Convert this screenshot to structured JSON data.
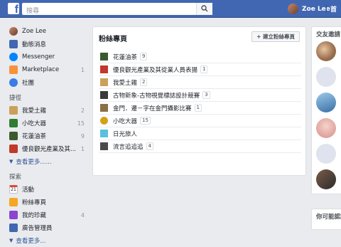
{
  "topbar": {
    "search_placeholder": "搜尋",
    "user_name": "Zoe Lee",
    "home": "首"
  },
  "sidebar": {
    "profile": "Zoe Lee",
    "items": [
      {
        "label": "動態消息",
        "count": ""
      },
      {
        "label": "Messenger",
        "count": ""
      },
      {
        "label": "Marketplace",
        "count": "1"
      },
      {
        "label": "社團",
        "count": ""
      }
    ],
    "shortcuts_title": "捷徑",
    "shortcuts": [
      {
        "label": "我愛土雞",
        "count": "2"
      },
      {
        "label": "小吃大器",
        "count": "15"
      },
      {
        "label": "花蓮油茶",
        "count": "9"
      },
      {
        "label": "優良觀光產業及其...",
        "count": "1"
      }
    ],
    "see_more_1": "查看更多......",
    "explore_title": "探索",
    "explore": [
      {
        "label": "活動",
        "count": "",
        "icon_text": "21"
      },
      {
        "label": "粉絲專頁",
        "count": ""
      },
      {
        "label": "我的珍藏",
        "count": "4"
      },
      {
        "label": "廣告管理員",
        "count": ""
      }
    ],
    "see_more_2": "查看更多..."
  },
  "pages_panel": {
    "title": "粉絲專頁",
    "create_button": "+ 建立粉絲專頁",
    "rows": [
      {
        "name": "花蓮油茶",
        "badge": "9",
        "color": "#3b5a2f"
      },
      {
        "name": "優良觀光產業及其從業人員表揚",
        "badge": "1",
        "color": "#c0392b"
      },
      {
        "name": "我愛土雞",
        "badge": "2",
        "color": "#c9a15a"
      },
      {
        "name": "古物新象-古物視覺標誌設計競賽",
        "badge": "3",
        "color": "#3a3a3a"
      },
      {
        "name": "金門．遷－字在金門攝影比賽",
        "badge": "1",
        "color": "#8b6f47"
      },
      {
        "name": "小吃大器",
        "badge": "15",
        "color": "#d4a017"
      },
      {
        "name": "日光旅人",
        "badge": "",
        "color": "#5bc0de"
      },
      {
        "name": "流言追追追",
        "badge": "4",
        "color": "#4a4a4a"
      }
    ]
  },
  "right_column": {
    "friend_requests_title": "交友邀請",
    "suggestions_title": "你可能認識"
  },
  "colors": {
    "brand": "#4267b2",
    "link": "#365899"
  }
}
